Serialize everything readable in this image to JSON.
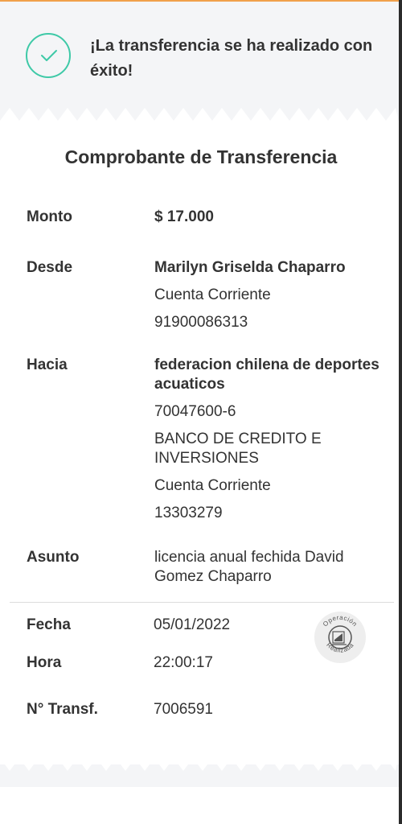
{
  "success": {
    "message": "¡La transferencia se ha realizado con éxito!"
  },
  "receipt": {
    "title": "Comprobante de Transferencia",
    "monto": {
      "label": "Monto",
      "value": "$ 17.000"
    },
    "desde": {
      "label": "Desde",
      "name": "Marilyn Griselda Chaparro",
      "account_type": "Cuenta Corriente",
      "account_number": "91900086313"
    },
    "hacia": {
      "label": "Hacia",
      "name": "federacion chilena de deportes acuaticos",
      "rut": "70047600-6",
      "bank": "BANCO DE CREDITO E INVERSIONES",
      "account_type": "Cuenta Corriente",
      "account_number": "13303279"
    },
    "asunto": {
      "label": "Asunto",
      "value": "licencia anual fechida David Gomez Chaparro"
    },
    "fecha": {
      "label": "Fecha",
      "value": "05/01/2022"
    },
    "hora": {
      "label": "Hora",
      "value": "22:00:17"
    },
    "transf": {
      "label": "N° Transf.",
      "value": "7006591"
    },
    "stamp": {
      "top_text": "Operación",
      "bottom_text": "Realizada"
    }
  },
  "colors": {
    "accent_orange": "#f0a04b",
    "success_green": "#3ec9a7",
    "background": "#f4f5f7"
  },
  "icons": {
    "success": "check-circle-icon",
    "stamp": "operation-stamp-icon"
  }
}
